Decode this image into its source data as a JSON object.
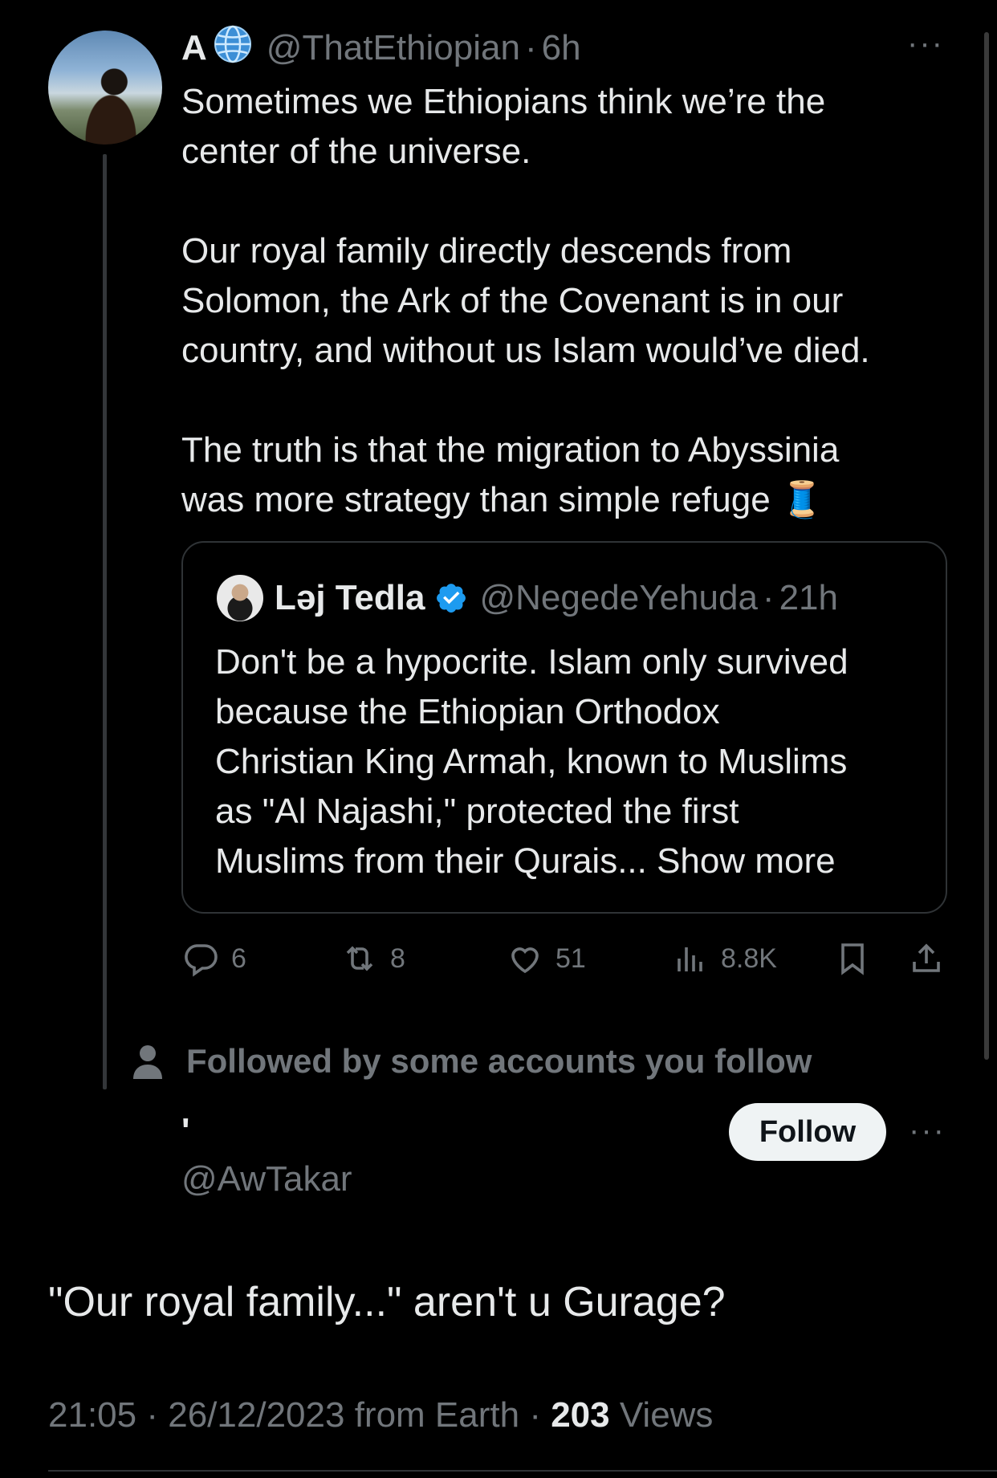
{
  "tweet": {
    "author_name": "A",
    "author_handle": "@ThatEthiopian",
    "time_sep": "·",
    "time": "6h",
    "more_glyph": "···",
    "text": "Sometimes we Ethiopians think we’re the\ncenter of the universe.\n\nOur royal family directly descends from\nSolomon, the Ark of the Covenant is in our\ncountry, and without us Islam would’ve died.\n\nThe truth is that the migration to Abyssinia\nwas more strategy than simple refuge 🧵"
  },
  "quote": {
    "author_name": "Ləj Tedla",
    "author_handle": "@NegedeYehuda",
    "time_sep": "·",
    "time": "21h",
    "text": "Don't be a hypocrite. Islam only survived\nbecause the Ethiopian Orthodox\nChristian King Armah, known to Muslims\nas \"Al Najashi,\" protected the first\nMuslims from their Qurais... Show more"
  },
  "actions": {
    "replies": "6",
    "reposts": "8",
    "likes": "51",
    "views": "8.8K"
  },
  "social_context": {
    "text": "Followed by some accounts you follow"
  },
  "reply_author": {
    "name": "'",
    "handle": "@AwTakar",
    "follow_label": "Follow",
    "more_glyph": "···"
  },
  "reply": {
    "text": "\"Our royal family...\" aren't u Gurage?",
    "time": "21:05",
    "sep": "·",
    "date": "26/12/2023",
    "source": "from Earth",
    "views_count": "203",
    "views_label": "Views"
  },
  "colors": {
    "background": "#000000",
    "text": "#e7e9ea",
    "muted": "#71767b",
    "verified": "#1d9bf0"
  }
}
